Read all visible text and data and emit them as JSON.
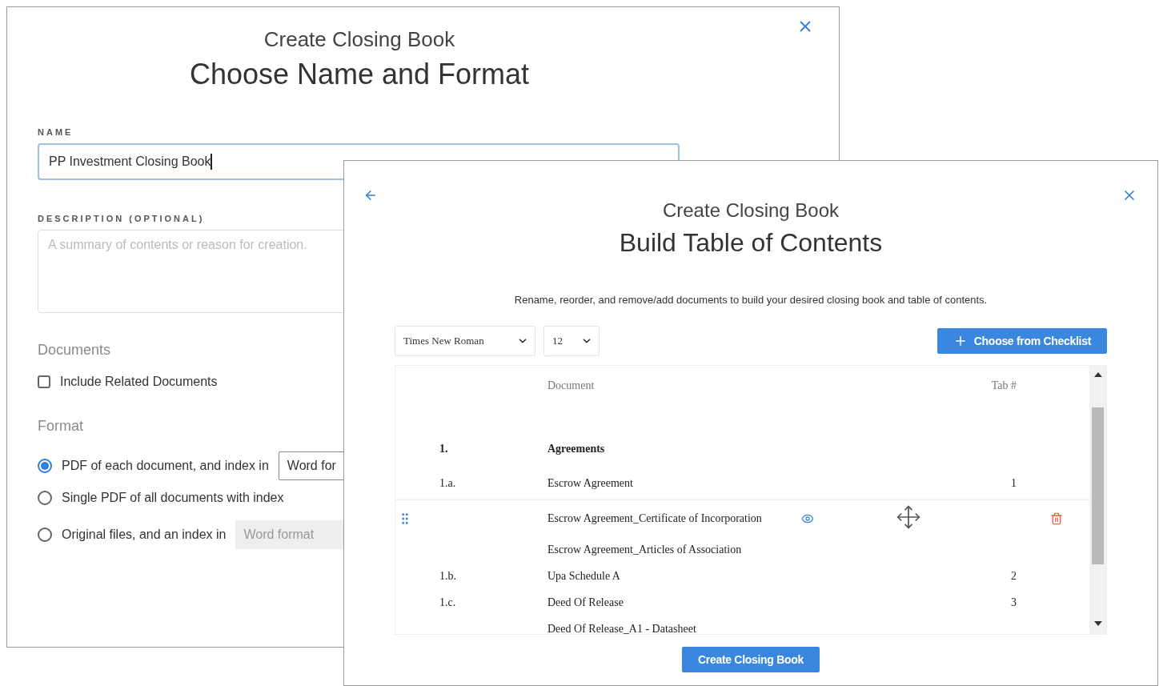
{
  "back_dialog": {
    "subtitle": "Create Closing Book",
    "title": "Choose Name and Format",
    "name_label": "NAME",
    "name_value": "PP Investment Closing Book",
    "description_label": "DESCRIPTION (OPTIONAL)",
    "description_placeholder": "A summary of contents or reason for creation.",
    "documents_heading": "Documents",
    "include_related": {
      "label": "Include Related Documents",
      "checked": false
    },
    "format_heading": "Format",
    "format_options": [
      {
        "label": "PDF of each document, and index in",
        "selected": true,
        "select": {
          "value": "Word for",
          "disabled": false
        }
      },
      {
        "label": "Single PDF of all documents with index",
        "selected": false
      },
      {
        "label": "Original files, and an index in",
        "selected": false,
        "select": {
          "value": "Word format",
          "disabled": true
        }
      }
    ]
  },
  "front_dialog": {
    "subtitle": "Create Closing Book",
    "title": "Build Table of Contents",
    "instructions": "Rename, reorder, and remove/add documents to build your desired closing book and table of contents.",
    "font_select": "Times New Roman",
    "size_select": "12",
    "checklist_button": "Choose from Checklist",
    "columns": [
      "Document",
      "Tab #"
    ],
    "rows": [
      {
        "kind": "section",
        "number": "1.",
        "document": "Agreements",
        "dragging": false
      },
      {
        "kind": "document",
        "number": "1.a.",
        "document": "Escrow Agreement",
        "tab": "1",
        "dragging": false
      },
      {
        "kind": "document",
        "document": "Escrow Agreement_Certificate of Incorporation",
        "dragging": true
      },
      {
        "kind": "document",
        "document": "Escrow Agreement_Articles of Association",
        "dragging": false
      },
      {
        "kind": "document",
        "number": "1.b.",
        "document": "Upa Schedule A",
        "tab": "2",
        "dragging": false
      },
      {
        "kind": "document",
        "number": "1.c.",
        "document": "Deed Of Release",
        "tab": "3",
        "dragging": false
      },
      {
        "kind": "document",
        "document": "Deed Of Release_A1 - Datasheet",
        "dragging": false
      }
    ],
    "create_button": "Create Closing Book"
  }
}
